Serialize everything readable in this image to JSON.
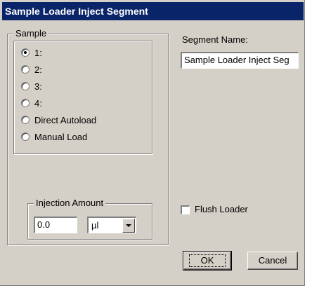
{
  "dialog": {
    "title": "Sample Loader Inject Segment"
  },
  "sample_group": {
    "legend": "Sample",
    "options": [
      {
        "label": "1:",
        "checked": true
      },
      {
        "label": "2:",
        "checked": false
      },
      {
        "label": "3:",
        "checked": false
      },
      {
        "label": "4:",
        "checked": false
      },
      {
        "label": "Direct Autoload",
        "checked": false
      },
      {
        "label": "Manual Load",
        "checked": false
      }
    ]
  },
  "injection": {
    "legend": "Injection Amount",
    "amount_value": "0.0",
    "unit_value": "µl"
  },
  "segment": {
    "name_label": "Segment Name:",
    "name_value": "Sample Loader Inject Seg"
  },
  "flush": {
    "label": "Flush Loader",
    "checked": false
  },
  "buttons": {
    "ok": "OK",
    "cancel": "Cancel"
  }
}
